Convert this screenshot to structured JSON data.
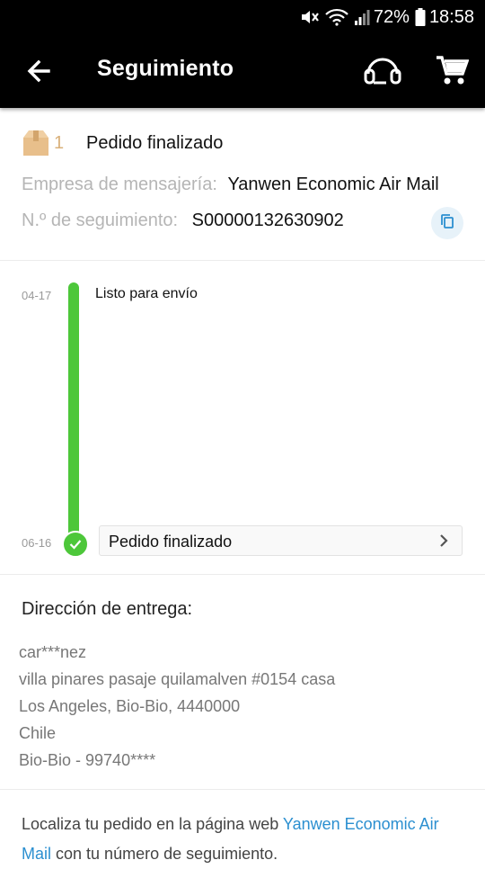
{
  "status_bar": {
    "battery_percent": "72%",
    "time": "18:58"
  },
  "app_bar": {
    "title": "Seguimiento",
    "icons": [
      "back-arrow-icon",
      "headset-support-icon",
      "shopping-cart-icon"
    ]
  },
  "header": {
    "package_icon": "package-box-icon",
    "package_count": "1",
    "status_title": "Pedido finalizado",
    "courier_label": "Empresa de mensajería:",
    "courier_value": "Yanwen Economic Air Mail",
    "tracking_label": "N.º de seguimiento:",
    "tracking_value": "S00000132630902",
    "copy_icon": "copy-icon"
  },
  "timeline": {
    "events": [
      {
        "date": "04-17",
        "label": "Listo para envío"
      },
      {
        "date": "06-16",
        "label": "Pedido finalizado"
      }
    ],
    "colors": {
      "line": "#4dc73a"
    }
  },
  "address": {
    "title": "Dirección de entrega:",
    "lines": [
      "car***nez",
      "villa pinares pasaje quilamalven #0154 casa",
      "Los Angeles, Bio-Bio, 4440000",
      "Chile",
      "Bio-Bio - 99740****"
    ]
  },
  "note": {
    "prefix": "Localiza tu pedido en la página web ",
    "link": "Yanwen Economic Air Mail",
    "suffix": " con tu número de seguimiento.",
    "link_color": "#2b8fd0"
  }
}
